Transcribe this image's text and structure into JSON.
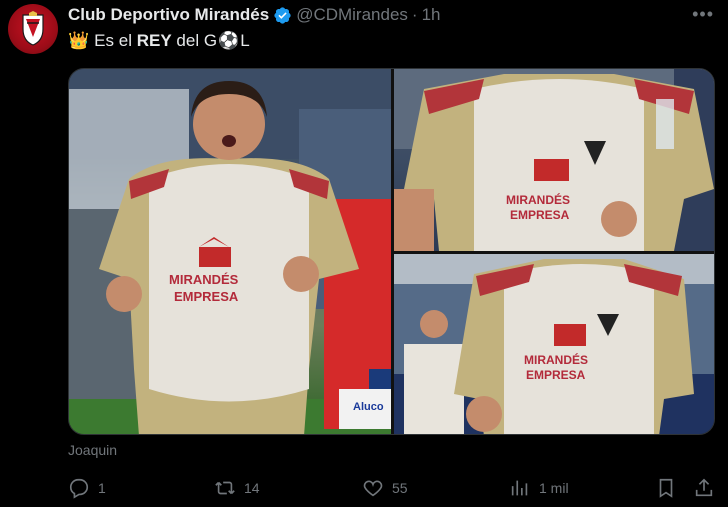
{
  "author": {
    "name": "Club Deportivo Mirandés",
    "handle": "@CDMirandes",
    "separator": "·",
    "time": "1h",
    "verified_icon": "verified-badge-icon",
    "avatar_colors": {
      "primary": "#c41222",
      "dark": "#6d0a12"
    }
  },
  "tweet": {
    "crown_emoji": "👑",
    "text_before_bold": "Es el",
    "bold_text": "REY",
    "text_middle": "del G",
    "ball_emoji": "⚽",
    "text_end": "L"
  },
  "media": {
    "photos": [
      {
        "description_name": "photo-player-celebrating"
      },
      {
        "description_name": "photo-jersey-closeup-top"
      },
      {
        "description_name": "photo-jersey-closeup-bottom"
      }
    ],
    "jersey_text": "MIRANDÉS EMPRESA",
    "ad_text": "Aluco"
  },
  "alt_caption": "Joaquin",
  "actions": {
    "reply_count": "1",
    "retweet_count": "14",
    "like_count": "55",
    "views_count": "1 mil"
  },
  "colors": {
    "background": "#000000",
    "text_primary": "#e7e9ea",
    "text_secondary": "#71767b",
    "verified_blue": "#1d9bf0"
  }
}
